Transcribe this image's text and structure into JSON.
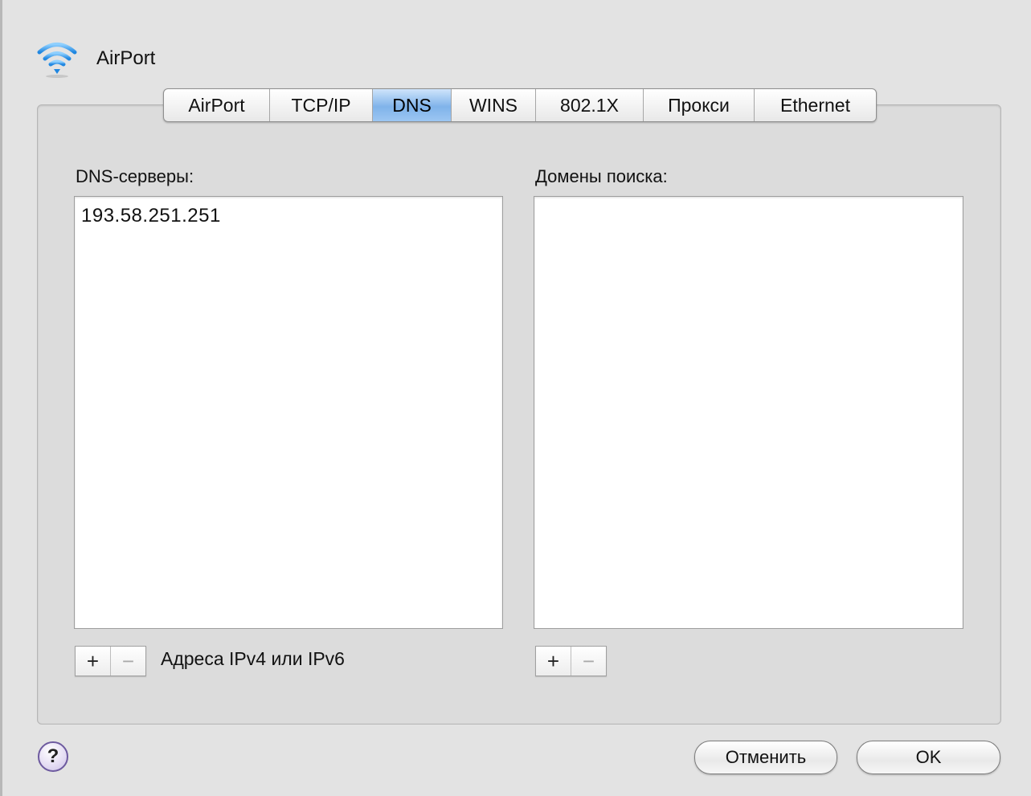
{
  "header": {
    "title": "AirPort",
    "icon": "wifi-icon"
  },
  "tabs": [
    {
      "label": "AirPort",
      "active": false
    },
    {
      "label": "TCP/IP",
      "active": false
    },
    {
      "label": "DNS",
      "active": true
    },
    {
      "label": "WINS",
      "active": false
    },
    {
      "label": "802.1X",
      "active": false
    },
    {
      "label": "Прокси",
      "active": false
    },
    {
      "label": "Ethernet",
      "active": false
    }
  ],
  "dns": {
    "servers_label": "DNS-серверы:",
    "servers": [
      "193.58.251.251"
    ],
    "search_domains_label": "Домены поиска:",
    "search_domains": [],
    "hint": "Адреса IPv4 или IPv6",
    "add_symbol": "+",
    "remove_symbol": "−"
  },
  "footer": {
    "help_symbol": "?",
    "cancel_label": "Отменить",
    "ok_label": "OK"
  },
  "colors": {
    "active_tab": "#7fb3ea",
    "window_bg": "#e3e3e3",
    "help_ring": "#6d5a9f"
  }
}
